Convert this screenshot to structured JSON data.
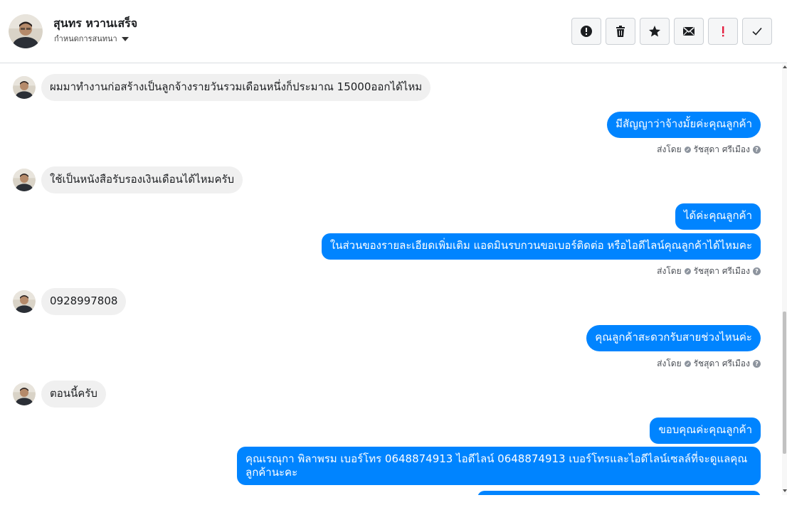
{
  "header": {
    "contact_name": "สุนทร หวานเสร็จ",
    "subtitle": "กำหนดการสนทนา",
    "avatar_icon": "user-avatar-icon"
  },
  "toolbar": [
    {
      "name": "report-spam-button",
      "icon": "alert-circle-icon"
    },
    {
      "name": "delete-button",
      "icon": "trash-icon"
    },
    {
      "name": "star-button",
      "icon": "star-icon"
    },
    {
      "name": "mark-unread-button",
      "icon": "envelope-icon"
    },
    {
      "name": "mark-important-button",
      "icon": "exclamation-icon",
      "color": "#e41e3f"
    },
    {
      "name": "mark-done-button",
      "icon": "check-icon"
    }
  ],
  "colors": {
    "outgoing_bubble": "#0084ff",
    "incoming_bubble": "#f0f0f0"
  },
  "messages": [
    {
      "direction": "in",
      "text": "ผมมาทำงานก่อสร้างเป็นลูกจ้างรายวันรวมเดือนหนึ่งก็ประมาณ 15000ออกได้ไหม"
    },
    {
      "direction": "out",
      "text": "มีสัญญาว่าจ้างมั้ยค่ะคุณลูกค้า"
    },
    {
      "direction": "in",
      "text": "ใช้เป็นหนังสือรับรองเงินเดือนได้ไหมครับ"
    },
    {
      "direction": "out",
      "text": "ได้ค่ะคุณลูกค้า"
    },
    {
      "direction": "out",
      "text": "ในส่วนของรายละเอียดเพิ่มเติม แอดมินรบกวนขอเบอร์ติดต่อ หรือไอดีไลน์คุณลูกค้าได้ไหมคะ"
    },
    {
      "direction": "in",
      "text": "0928997808"
    },
    {
      "direction": "out",
      "text": "คุณลูกค้าสะดวกรับสายช่วงไหนค่ะ"
    },
    {
      "direction": "in",
      "text": "ตอนนี้ครับ"
    },
    {
      "direction": "out",
      "text": "ขอบคุณค่ะคุณลูกค้า"
    },
    {
      "direction": "out",
      "text": "คุณเรณุกา พิลาพรม       เบอร์โทร 0648874913  ไอดีไลน์ 0648874913  เบอร์โทรและไอดีไลน์เซลล์ที่จะดูแลคุณลูกค้านะคะ"
    }
  ],
  "sent_by": {
    "label": "ส่งโดย",
    "agent": "รัชสุดา ศรีเมือง"
  }
}
